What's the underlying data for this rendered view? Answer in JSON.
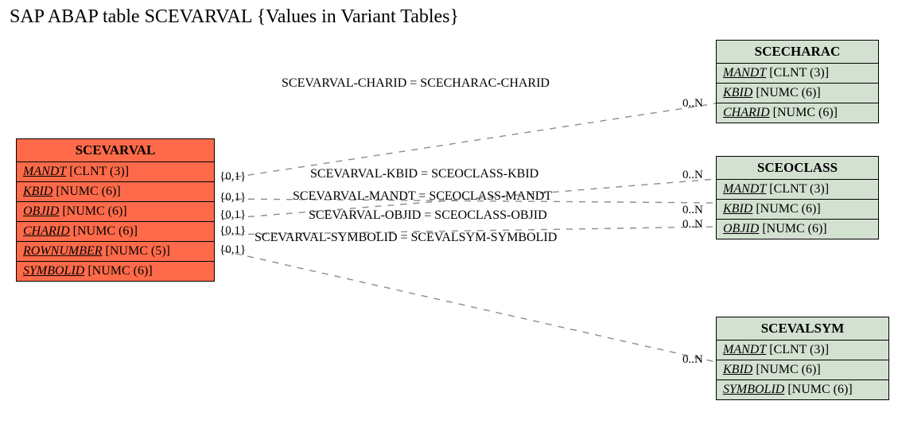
{
  "title": "SAP ABAP table SCEVARVAL {Values in Variant Tables}",
  "main_entity": {
    "name": "SCEVARVAL",
    "fields": [
      {
        "name": "MANDT",
        "type": "[CLNT (3)]"
      },
      {
        "name": "KBID",
        "type": "[NUMC (6)]"
      },
      {
        "name": "OBJID",
        "type": "[NUMC (6)]"
      },
      {
        "name": "CHARID",
        "type": "[NUMC (6)]"
      },
      {
        "name": "ROWNUMBER",
        "type": "[NUMC (5)]"
      },
      {
        "name": "SYMBOLID",
        "type": "[NUMC (6)]"
      }
    ]
  },
  "related_entities": [
    {
      "name": "SCECHARAC",
      "fields": [
        {
          "name": "MANDT",
          "type": "[CLNT (3)]"
        },
        {
          "name": "KBID",
          "type": "[NUMC (6)]"
        },
        {
          "name": "CHARID",
          "type": "[NUMC (6)]"
        }
      ]
    },
    {
      "name": "SCEOCLASS",
      "fields": [
        {
          "name": "MANDT",
          "type": "[CLNT (3)]"
        },
        {
          "name": "KBID",
          "type": "[NUMC (6)]"
        },
        {
          "name": "OBJID",
          "type": "[NUMC (6)]"
        }
      ]
    },
    {
      "name": "SCEVALSYM",
      "fields": [
        {
          "name": "MANDT",
          "type": "[CLNT (3)]"
        },
        {
          "name": "KBID",
          "type": "[NUMC (6)]"
        },
        {
          "name": "SYMBOLID",
          "type": "[NUMC (6)]"
        }
      ]
    }
  ],
  "relations": [
    {
      "label": "SCEVARVAL-CHARID = SCECHARAC-CHARID",
      "left_card": "{0,1}",
      "right_card": "0..N"
    },
    {
      "label": "SCEVARVAL-KBID = SCEOCLASS-KBID",
      "left_card": "{0,1}",
      "right_card": "0..N"
    },
    {
      "label": "SCEVARVAL-MANDT = SCEOCLASS-MANDT",
      "left_card": "{0,1}",
      "right_card": "0..N"
    },
    {
      "label": "SCEVARVAL-OBJID = SCEOCLASS-OBJID",
      "left_card": "{0,1}",
      "right_card": "0..N"
    },
    {
      "label": "SCEVARVAL-SYMBOLID = SCEVALSYM-SYMBOLID",
      "left_card": "{0,1}",
      "right_card": "0..N"
    }
  ]
}
